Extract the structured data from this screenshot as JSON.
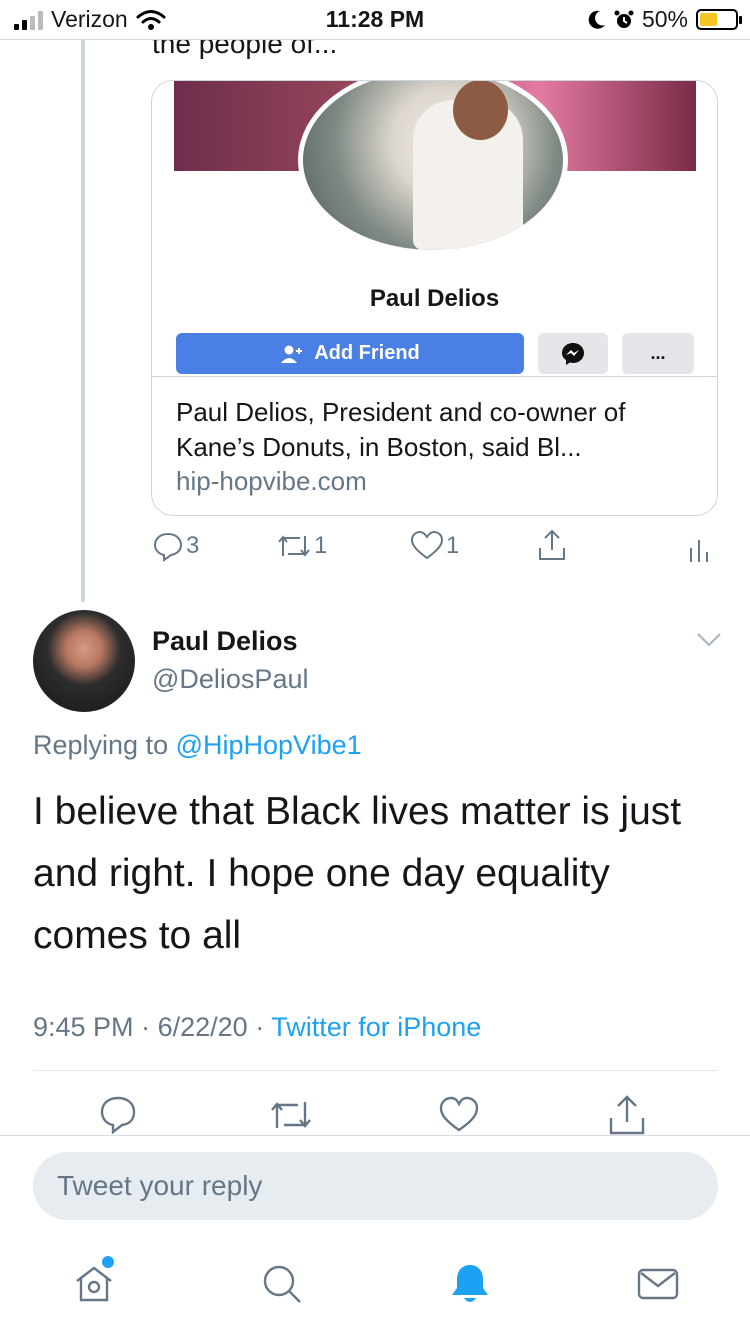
{
  "status_bar": {
    "carrier": "Verizon",
    "time": "11:28 PM",
    "battery": "50%",
    "battery_level": 0.5
  },
  "previous_tweet": {
    "truncated_text": "the people of...",
    "card": {
      "fb_profile_name": "Paul Delios",
      "add_friend_label": "Add Friend",
      "more_label": "...",
      "title": "Paul Delios, President and co-owner of Kane’s Donuts, in Boston, said Bl...",
      "domain": "hip-hopvibe.com"
    },
    "actions": {
      "reply_count": "3",
      "retweet_count": "1",
      "like_count": "1"
    }
  },
  "tweet": {
    "display_name": "Paul Delios",
    "handle": "@DeliosPaul",
    "replying_prefix": "Replying to",
    "replying_to": "@HipHopVibe1",
    "text": "I believe that Black lives matter is just and right. I hope one day equality comes to all",
    "time": "9:45 PM",
    "date": "6/22/20",
    "separator": "·",
    "source": "Twitter for iPhone"
  },
  "reply_box": {
    "placeholder": "Tweet your reply"
  },
  "tab_bar": {
    "items": [
      "home-icon",
      "search-icon",
      "notifications-icon",
      "messages-icon"
    ],
    "active": "notifications-icon"
  },
  "colors": {
    "accent": "#1da1f2",
    "muted": "#657786",
    "facebook_button": "#4a7fe6"
  }
}
